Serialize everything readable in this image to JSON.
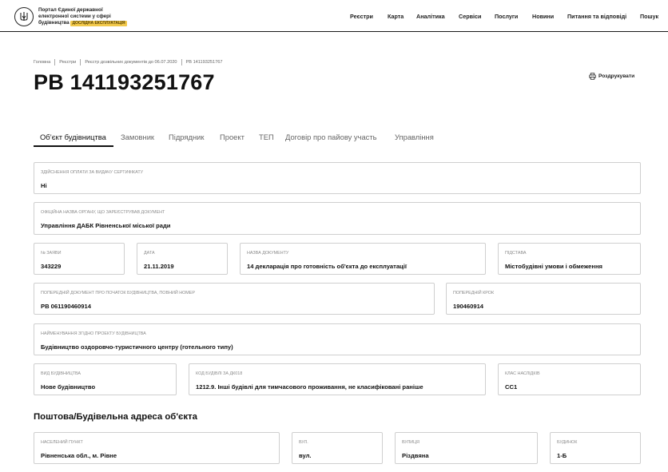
{
  "header": {
    "brand_line1": "Портал Єдиної державної",
    "brand_line2": "електронної системи у сфері",
    "brand_line3": "будівництва",
    "brand_badge": "ДОСЛІДНА ЕКСПЛУАТАЦІЯ",
    "nav": [
      "Реєстри",
      "Карта",
      "Аналітика",
      "Сервіси",
      "Послуги",
      "Новини",
      "Питання та відповіді",
      "Пошук"
    ]
  },
  "breadcrumb": [
    "Головна",
    "Реєстри",
    "Реєстр дозвільних документів до 06.07.2020",
    "РВ 141193251767"
  ],
  "page_title": "РВ 141193251767",
  "print_label": "Роздрукувати",
  "tabs": [
    "Об’єкт будівництва",
    "Замовник",
    "Підрядник",
    "Проект",
    "ТЕП",
    "Договір про пайову участь",
    "Управління"
  ],
  "fields": {
    "payment": {
      "label": "Здійснення оплати за видачу сертифікату",
      "value": "Ні"
    },
    "organ": {
      "label": "Офіційна назва органу, що зареєстрував документ",
      "value": "Управління ДАБК Рівненської міської ради"
    },
    "app_no": {
      "label": "№ заяви",
      "value": "343229"
    },
    "date": {
      "label": "Дата",
      "value": "21.11.2019"
    },
    "doc_name": {
      "label": "Назва документу",
      "value": "14 декларація про готовність об'єкта до експлуатації"
    },
    "basis": {
      "label": "Підстава",
      "value": "Містобудівні умови і обмеження"
    },
    "prev_doc": {
      "label": "Попередній документ про початок будівництва, повний номер",
      "value": "РВ 061190460914"
    },
    "prev_step": {
      "label": "Попередній крок",
      "value": "190460914"
    },
    "project_name": {
      "label": "Найменування згідно проекту будівництва",
      "value": "Будівництво оздоровчо-туристичного центру (готельного типу)"
    },
    "build_type": {
      "label": "Вид будівництва",
      "value": "Нове будівництво"
    },
    "dk018": {
      "label": "Код будівлі за ДК018",
      "value": "1212.9. Інші будівлі для тимчасового проживання, не класифіковані раніше"
    },
    "class": {
      "label": "Клас наслідків",
      "value": "СС1"
    }
  },
  "address_section": {
    "title": "Поштова/Будівельна адреса об'єкта",
    "settlement": {
      "label": "Населений пункт",
      "value": "Рівненська обл., м. Рівне"
    },
    "street_type": {
      "label": "Вул.",
      "value": "вул."
    },
    "street": {
      "label": "Вулиця",
      "value": "Різдвяна"
    },
    "building": {
      "label": "Будинок",
      "value": "1-Б"
    }
  }
}
